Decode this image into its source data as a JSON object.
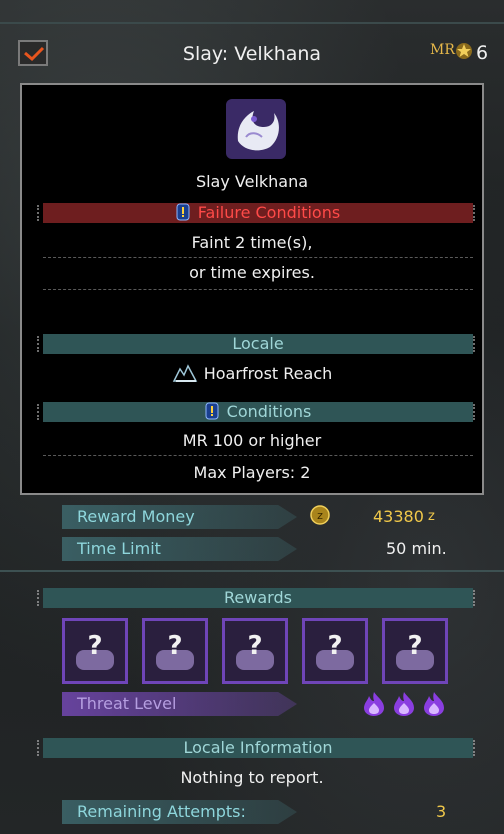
{
  "header": {
    "title": "Slay: Velkhana",
    "mr_label": "MR",
    "mr_value": "6"
  },
  "quest": {
    "monster_name": "Slay Velkhana",
    "failure_title": "Failure Conditions",
    "failure_lines": [
      "Faint 2 time(s),",
      "or time expires."
    ],
    "locale_title": "Locale",
    "locale_name": "Hoarfrost Reach",
    "conditions_title": "Conditions",
    "conditions_lines": [
      "MR 100 or higher",
      "Max Players: 2"
    ]
  },
  "info": {
    "reward_money_label": "Reward Money",
    "reward_money_value": "43380",
    "reward_money_unit": "z",
    "time_limit_label": "Time Limit",
    "time_limit_value": "50 min."
  },
  "rewards": {
    "title": "Rewards",
    "items": [
      "?",
      "?",
      "?",
      "?",
      "?"
    ],
    "threat_label": "Threat Level",
    "threat_level": 3
  },
  "locale_info": {
    "title": "Locale Information",
    "text": "Nothing to report."
  },
  "attempts": {
    "label": "Remaining Attempts:",
    "value": "3"
  },
  "colors": {
    "accent_teal": "#2f5556",
    "failure_red": "#6e1e1f",
    "reward_purple": "#6f45b8",
    "gold": "#e6b84a"
  }
}
